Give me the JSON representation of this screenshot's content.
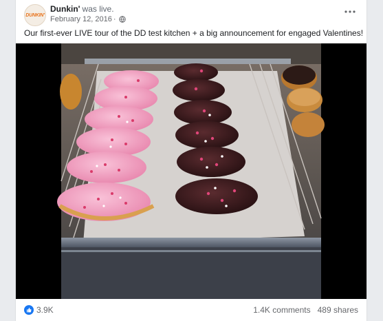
{
  "post": {
    "page_name": "Dunkin'",
    "status": "was live.",
    "avatar_text": "DUNKIN'",
    "date": "February 12, 2016",
    "date_separator": "·",
    "text": "Our first-ever LIVE tour of the DD test kitchen + a big announcement for engaged Valentines!"
  },
  "icons": {
    "avatar": "dunkin-logo",
    "privacy": "globe-icon",
    "menu": "more-options-icon",
    "reaction": "like-icon"
  },
  "footer": {
    "reactions_count": "3.9K",
    "comments": "1.4K comments",
    "shares": "489 shares"
  },
  "colors": {
    "brand_orange": "#e8741e",
    "like_blue": "#1877f2",
    "pink_frosting": "#f5a9c6",
    "chocolate": "#3a1a1c"
  }
}
